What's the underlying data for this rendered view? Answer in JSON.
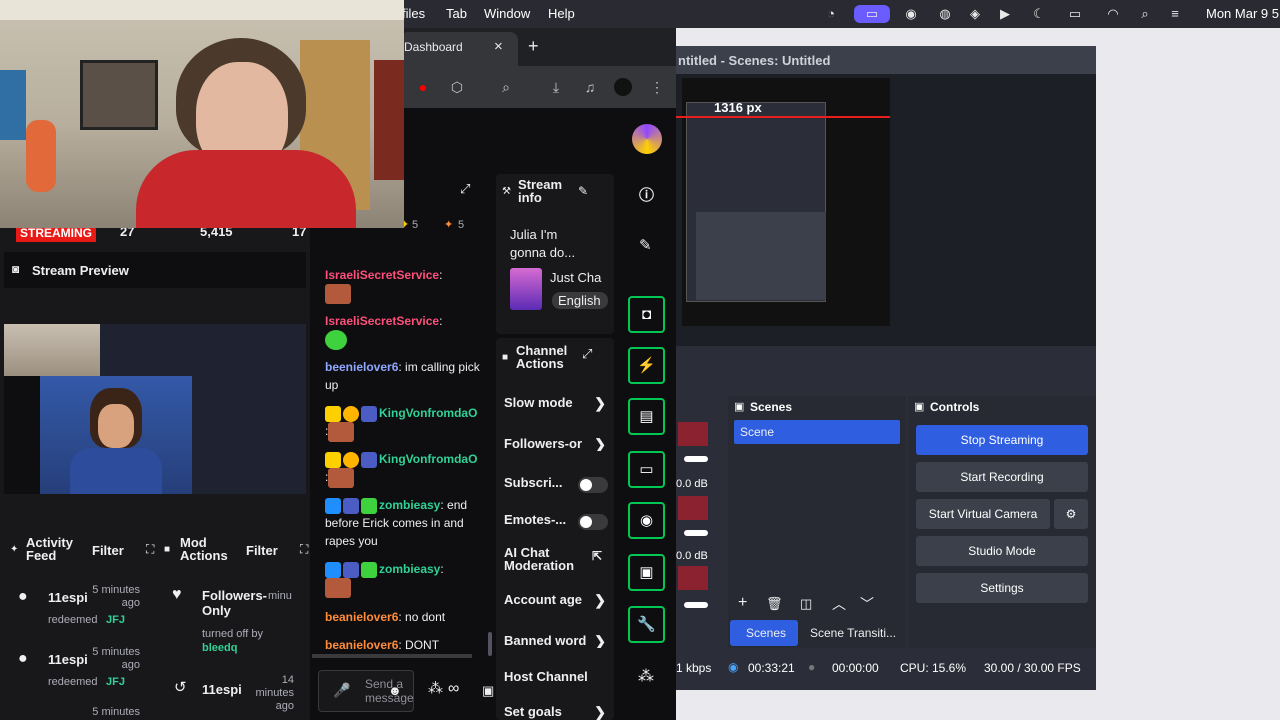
{
  "menubar": {
    "items": [
      "files",
      "Tab",
      "Window",
      "Help"
    ],
    "clock": "Mon Mar 9  5"
  },
  "browser": {
    "tab_title": "Dashboard",
    "tab_close": "×",
    "new_tab": "+"
  },
  "dashboard": {
    "status": {
      "badge": "STREAMING",
      "stat_1": "27",
      "stat_2": "5,415",
      "stat_3": "17"
    },
    "stream_preview": {
      "title": "Stream Preview"
    },
    "activity_feed": {
      "title": "Activity Feed",
      "filter": "Filter",
      "items": [
        {
          "user": "11espi",
          "time": "5 minutes ago",
          "action": "redeemed",
          "reward": "JFJ"
        },
        {
          "user": "11espi",
          "time": "5 minutes ago",
          "action": "redeemed",
          "reward": "JFJ"
        },
        {
          "user": "",
          "time": "5 minutes",
          "action": "",
          "reward": ""
        }
      ]
    },
    "mod_actions": {
      "title": "Mod Actions",
      "filter": "Filter",
      "items": [
        {
          "title": "Followers-Only",
          "time": "minu",
          "detail": "turned off by",
          "mod": "bleedq"
        },
        {
          "title": "11espi",
          "time": "14 minutes ago",
          "detail": "",
          "mod": ""
        }
      ]
    },
    "chat": {
      "points_a": "5",
      "points_b": "5",
      "messages": [
        {
          "user": "IsraeliSecretService",
          "text": ":",
          "color": "#ff4f7b"
        },
        {
          "user": "IsraeliSecretService",
          "text": ":",
          "color": "#ff4f7b"
        },
        {
          "user": "beenielover6",
          "text": ": im calling pick up",
          "color": "#8fa8ff"
        },
        {
          "user": "KingVonfromdaO",
          "text": ":",
          "color": "#32d196"
        },
        {
          "user": "KingVonfromdaO",
          "text": ":",
          "color": "#32d196"
        },
        {
          "user": "zombieasy",
          "text": ": end before Erick comes in and rapes you",
          "color": "#32d196"
        },
        {
          "user": "zombieasy",
          "text": ":",
          "color": "#32d196"
        },
        {
          "user": "beanielover6",
          "text": ": no dont",
          "color": "#ff8c3a"
        },
        {
          "user": "beanielover6",
          "text": ": DONT",
          "color": "#ff8c3a"
        }
      ],
      "input_placeholder": "Send a message"
    },
    "stream_info": {
      "title": "Stream info",
      "stream_title": "Julia I'm gonna do...",
      "category": "Just Cha",
      "language": "English"
    },
    "channel_actions": {
      "title": "Channel Actions",
      "items": [
        {
          "label": "Slow mode",
          "kind": "chevron"
        },
        {
          "label": "Followers-or",
          "kind": "chevron"
        },
        {
          "label": "Subscri...",
          "kind": "toggle"
        },
        {
          "label": "Emotes-...",
          "kind": "toggle"
        },
        {
          "label": "AI Chat Moderation",
          "kind": "link"
        },
        {
          "label": "Account age",
          "kind": "chevron"
        },
        {
          "label": "Banned word",
          "kind": "chevron"
        },
        {
          "label": "Host Channel",
          "kind": "none"
        },
        {
          "label": "Set goals",
          "kind": "chevron"
        }
      ]
    }
  },
  "obs": {
    "title": "ntitled - Scenes: Untitled",
    "preview_measure": "1316 px",
    "scenes_title": "Scenes",
    "scene_item": "Scene",
    "controls_title": "Controls",
    "controls": [
      "Stop Streaming",
      "Start Recording",
      "Start Virtual Camera",
      "Studio Mode",
      "Settings"
    ],
    "tabs": [
      "Scenes",
      "Scene Transiti..."
    ],
    "mixer_db": [
      "0.0 dB",
      "0.0 dB"
    ],
    "status": {
      "kbps": "1 kbps",
      "live_time": "00:33:21",
      "rec_time": "00:00:00",
      "cpu": "CPU: 15.6%",
      "fps": "30.00 / 30.00 FPS"
    }
  },
  "colors": {
    "twitch_purple": "#9147ff",
    "obs_blue": "#2f5ee0",
    "streaming_red": "#e91916",
    "quick_green": "#00c853"
  }
}
